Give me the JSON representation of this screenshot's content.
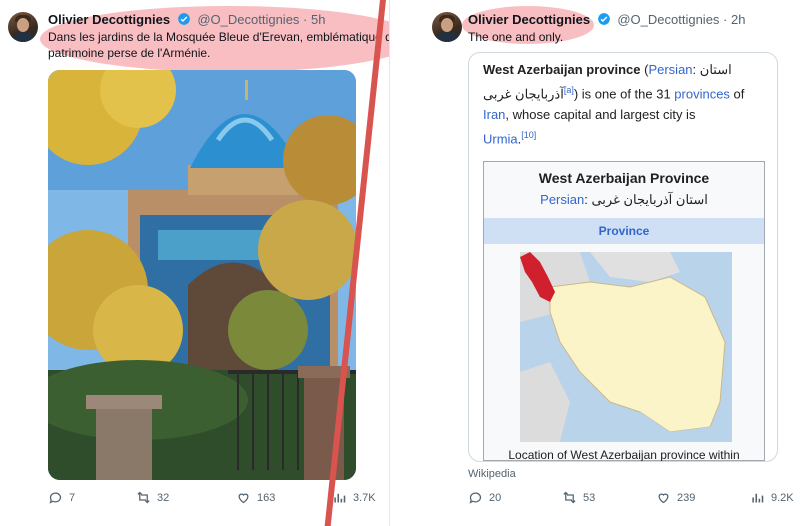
{
  "left_tweet": {
    "author_name": "Olivier Decottignies",
    "handle": "@O_Decottignies",
    "time": "· 5h",
    "text_line1": "Dans les jardins de la Mosquée Bleue d'Erevan, emblématique du",
    "text_line2": "patrimoine perse de l'Arménie.",
    "stats": {
      "replies": "7",
      "retweets": "32",
      "likes": "163",
      "views": "3.7K"
    }
  },
  "right_tweet": {
    "author_name": "Olivier Decottignies",
    "handle": "@O_Decottignies",
    "time": "· 2h",
    "text": "The one and only.",
    "stats": {
      "replies": "20",
      "retweets": "53",
      "likes": "239",
      "views": "9.2K"
    }
  },
  "wikipedia": {
    "intro_title": "West Azerbaijan province",
    "intro_paren_open": " (",
    "intro_persian_link": "Persian",
    "intro_persian_text": ": استان",
    "intro_line2_persian": "آذربایجان غربی",
    "intro_line2_sup": "[a]",
    "intro_line2_rest": " is one of the 31 ",
    "intro_provinces_link": "provinces",
    "intro_of": " of",
    "intro_iran_link": "Iran",
    "intro_line3_rest": ", whose capital and largest city is",
    "intro_urmia_link": "Urmia",
    "intro_urmia_end": ".",
    "intro_ref": "[10]",
    "infobox_title": "West Azerbaijan Province",
    "infobox_persian_label": "Persian",
    "infobox_persian_text": ": استان آذربایجان غربی",
    "infobox_band": "Province",
    "map_caption": "Location of West Azerbaijan province within",
    "source_label": "Wikipedia"
  },
  "colors": {
    "highlight": "#f06e78",
    "divider": "#d9534f",
    "link": "#3366cc",
    "verified": "#1d9bf0",
    "highlighted_region": "#d0202e"
  }
}
